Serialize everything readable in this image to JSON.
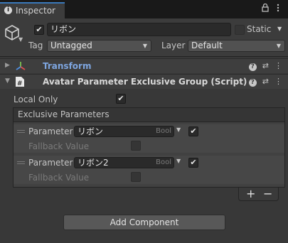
{
  "tab": {
    "title": "Inspector",
    "icons": [
      "info-icon",
      "lock-icon",
      "more-vert-icon"
    ]
  },
  "header": {
    "object_name": "リボン",
    "active_checked": true,
    "static_label": "Static",
    "static_checked": false,
    "tag_label": "Tag",
    "tag_value": "Untagged",
    "layer_label": "Layer",
    "layer_value": "Default"
  },
  "components": [
    {
      "name": "Transform",
      "expanded": false,
      "icon": "transform-icon"
    },
    {
      "name": "Avatar Parameter Exclusive Group (Script)",
      "expanded": true,
      "icon": "script-icon"
    }
  ],
  "script": {
    "local_only_label": "Local Only",
    "local_only_checked": true,
    "list_header": "Exclusive Parameters",
    "elements": [
      {
        "parameter_label": "Parameter",
        "parameter_value": "リボン",
        "type_tag": "Bool",
        "checked": true,
        "fallback_label": "Fallback Value",
        "fallback_checked": false
      },
      {
        "parameter_label": "Parameter",
        "parameter_value": "リボン2",
        "type_tag": "Bool",
        "checked": true,
        "fallback_label": "Fallback Value",
        "fallback_checked": false
      }
    ],
    "add_symbol": "+",
    "remove_symbol": "−"
  },
  "add_component_label": "Add Component"
}
